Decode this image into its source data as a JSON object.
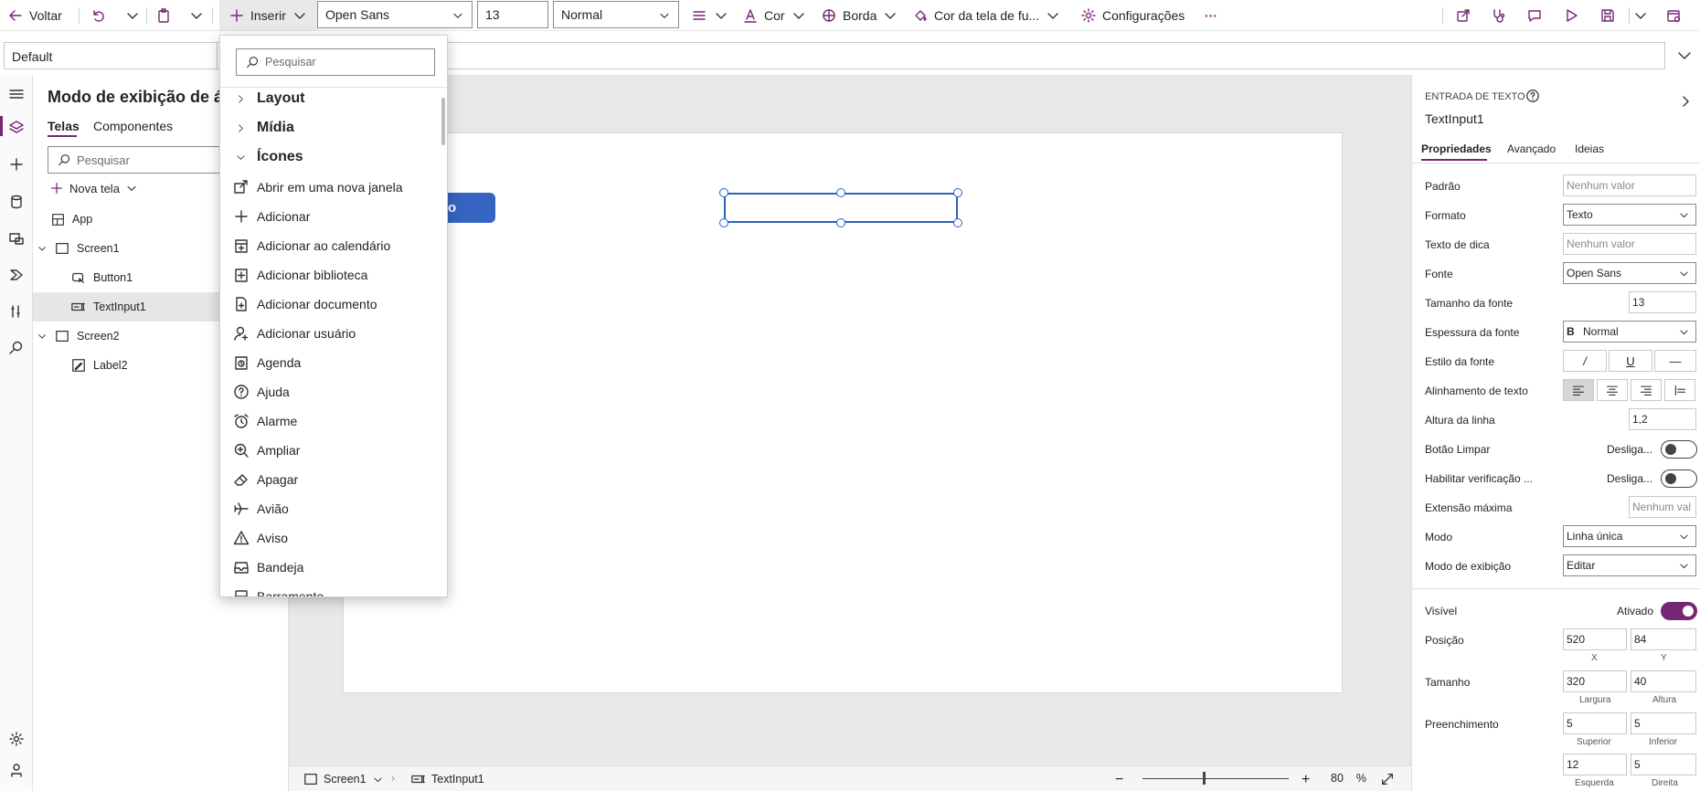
{
  "toolbar": {
    "back_label": "Voltar",
    "insert_label": "Inserir",
    "font_family_value": "Open Sans",
    "font_size_value": "13",
    "font_weight_value": "Normal",
    "color_label": "Cor",
    "border_label": "Borda",
    "fill_label": "Cor da tela de fu...",
    "settings_label": "Configurações",
    "more_label": "···"
  },
  "formula_bar": {
    "property_value": "Default",
    "formula_value": ""
  },
  "tree": {
    "title": "Modo de exibição de á",
    "tabs": [
      "Telas",
      "Componentes"
    ],
    "search_placeholder": "Pesquisar",
    "new_screen_label": "Nova tela",
    "nodes": [
      {
        "label": "App",
        "icon": "app-icon"
      },
      {
        "label": "Screen1",
        "icon": "screen-icon"
      },
      {
        "label": "Button1",
        "icon": "button-icon"
      },
      {
        "label": "TextInput1",
        "icon": "text-input-icon"
      },
      {
        "label": "Screen2",
        "icon": "screen-icon"
      },
      {
        "label": "Label2",
        "icon": "label-icon"
      }
    ]
  },
  "canvas": {
    "button_text": "o"
  },
  "status_bar": {
    "screen_label": "Screen1",
    "control_label": "TextInput1",
    "zoom_value": "80",
    "zoom_unit": "%",
    "zoom_min": "−",
    "zoom_max": "+"
  },
  "insert_menu": {
    "search_placeholder": "Pesquisar",
    "categories": [
      {
        "label": "Layout",
        "expanded": false
      },
      {
        "label": "Mídia",
        "expanded": false
      },
      {
        "label": "Ícones",
        "expanded": true
      }
    ],
    "items": [
      {
        "label": "Abrir em uma nova janela",
        "icon": "open-new-window-icon"
      },
      {
        "label": "Adicionar",
        "icon": "add-icon"
      },
      {
        "label": "Adicionar ao calendário",
        "icon": "add-calendar-icon"
      },
      {
        "label": "Adicionar biblioteca",
        "icon": "add-library-icon"
      },
      {
        "label": "Adicionar documento",
        "icon": "add-document-icon"
      },
      {
        "label": "Adicionar usuário",
        "icon": "add-user-icon"
      },
      {
        "label": "Agenda",
        "icon": "agenda-icon"
      },
      {
        "label": "Ajuda",
        "icon": "help-icon"
      },
      {
        "label": "Alarme",
        "icon": "alarm-icon"
      },
      {
        "label": "Ampliar",
        "icon": "zoom-in-icon"
      },
      {
        "label": "Apagar",
        "icon": "eraser-icon"
      },
      {
        "label": "Avião",
        "icon": "airplane-icon"
      },
      {
        "label": "Aviso",
        "icon": "warning-icon"
      },
      {
        "label": "Bandeja",
        "icon": "tray-icon"
      },
      {
        "label": "Barramento",
        "icon": "bus-icon"
      }
    ]
  },
  "props": {
    "type_label": "ENTRADA DE TEXTO",
    "control_name": "TextInput1",
    "tabs": [
      "Propriedades",
      "Avançado",
      "Ideias"
    ],
    "rows": {
      "padrao": {
        "label": "Padrão",
        "value": "Nenhum valor"
      },
      "formato": {
        "label": "Formato",
        "value": "Texto"
      },
      "texto_dica": {
        "label": "Texto de dica",
        "value": "Nenhum valor"
      },
      "fonte": {
        "label": "Fonte",
        "value": "Open Sans"
      },
      "tamanho_fonte": {
        "label": "Tamanho da fonte",
        "value": "13"
      },
      "espessura": {
        "label": "Espessura da fonte",
        "value": "Normal"
      },
      "estilo": {
        "label": "Estilo da fonte"
      },
      "alinhamento": {
        "label": "Alinhamento de texto"
      },
      "altura_linha": {
        "label": "Altura da linha",
        "value": "1,2"
      },
      "botao_limpar": {
        "label": "Botão Limpar",
        "state": "Desliga..."
      },
      "verificacao": {
        "label": "Habilitar verificação ...",
        "state": "Desliga..."
      },
      "extensao": {
        "label": "Extensão máxima",
        "value": "Nenhum val"
      },
      "modo": {
        "label": "Modo",
        "value": "Linha única"
      },
      "modo_exibicao": {
        "label": "Modo de exibição",
        "value": "Editar"
      },
      "visivel": {
        "label": "Visível",
        "state": "Ativado"
      },
      "posicao": {
        "label": "Posição",
        "x": "520",
        "y": "84",
        "x_label": "X",
        "y_label": "Y"
      },
      "tamanho": {
        "label": "Tamanho",
        "w": "320",
        "h": "40",
        "w_label": "Largura",
        "h_label": "Altura"
      },
      "preenchimento": {
        "label": "Preenchimento",
        "top": "5",
        "bottom": "5",
        "left": "12",
        "right": "5",
        "top_label": "Superior",
        "bottom_label": "Inferior",
        "left_label": "Esquerda",
        "right_label": "Direita"
      }
    },
    "style_buttons": [
      "/",
      "U",
      "—"
    ],
    "bold_glyph": "B"
  },
  "colors": {
    "accent": "#742774",
    "canvas_button": "#3564c1",
    "selection": "#2b62c0"
  }
}
